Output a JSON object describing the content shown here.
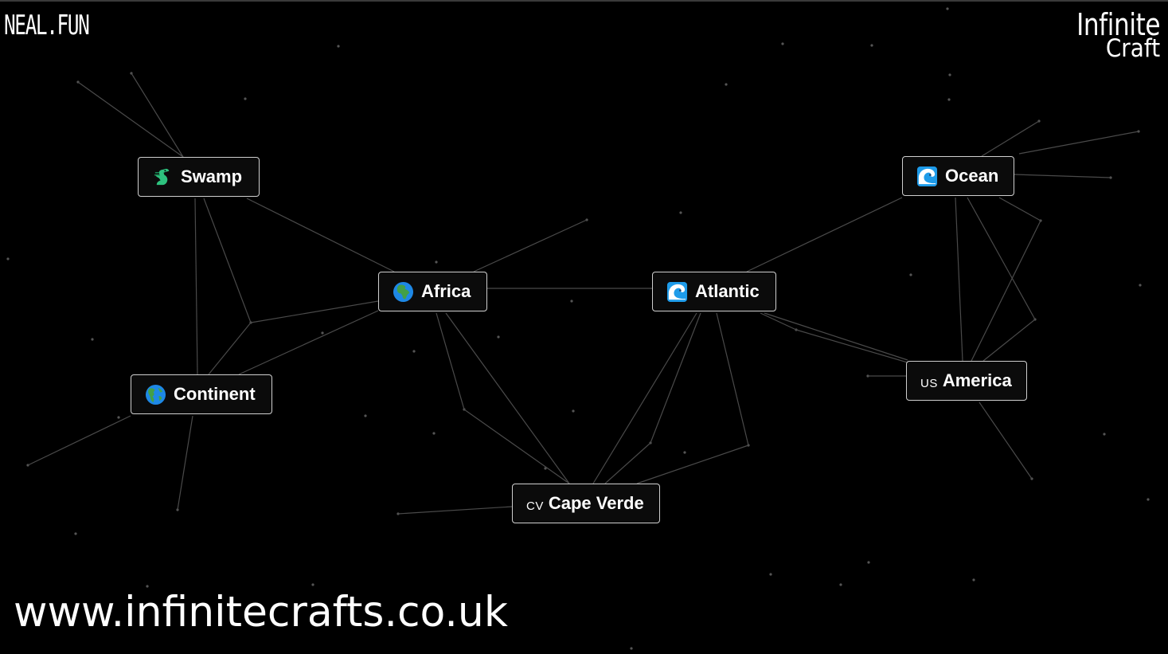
{
  "header": {
    "logo": "NEAL.FUN",
    "brand_line1": "Infinite",
    "brand_line2": "Craft"
  },
  "elements": [
    {
      "id": "swamp",
      "label": "Swamp",
      "icon": "crocodile-icon"
    },
    {
      "id": "africa",
      "label": "Africa",
      "icon": "globe-africa-icon"
    },
    {
      "id": "continent",
      "label": "Continent",
      "icon": "globe-americas-icon"
    },
    {
      "id": "atlantic",
      "label": "Atlantic",
      "icon": "water-wave-icon"
    },
    {
      "id": "ocean",
      "label": "Ocean",
      "icon": "water-wave-icon"
    },
    {
      "id": "america",
      "label": "America",
      "flag_code": "US"
    },
    {
      "id": "cape-verde",
      "label": "Cape Verde",
      "flag_code": "CV"
    }
  ],
  "footer": {
    "watermark": "www.infinitecrafts.co.uk"
  },
  "colors": {
    "background": "#000000",
    "node_border": "#cfcfcf",
    "line": "#4a4a4a"
  }
}
